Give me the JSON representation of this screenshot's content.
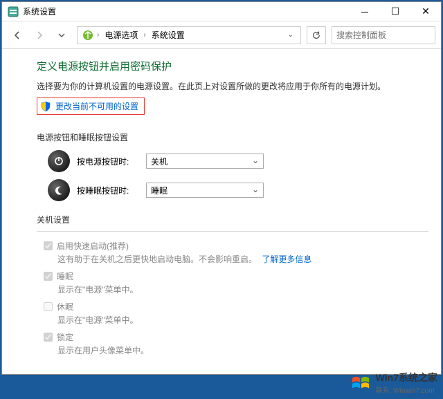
{
  "window": {
    "title": "系统设置"
  },
  "breadcrumb": {
    "item1": "电源选项",
    "item2": "系统设置"
  },
  "search": {
    "placeholder": "搜索控制面板"
  },
  "page": {
    "heading": "定义电源按钮并启用密码保护",
    "description": "选择要为你的计算机设置的电源设置。在此页上对设置所做的更改将应用于你所有的电源计划。",
    "change_link": "更改当前不可用的设置"
  },
  "power_buttons": {
    "section_title": "电源按钮和睡眠按钮设置",
    "power_press_label": "按电源按钮时:",
    "power_press_value": "关机",
    "sleep_press_label": "按睡眠按钮时:",
    "sleep_press_value": "睡眠"
  },
  "shutdown": {
    "section_title": "关机设置",
    "fast_startup_label": "启用快速启动(推荐)",
    "fast_startup_desc": "这有助于在关机之后更快地启动电脑。不会影响重启。",
    "learn_more": "了解更多信息",
    "sleep_label": "睡眠",
    "sleep_desc": "显示在\"电源\"菜单中。",
    "hibernate_label": "休眠",
    "hibernate_desc": "显示在\"电源\"菜单中。",
    "lock_label": "锁定",
    "lock_desc": "显示在用户头像菜单中。"
  },
  "watermark": {
    "brand": "Win7系统之家",
    "domain": "联系: Winwin7.com"
  }
}
